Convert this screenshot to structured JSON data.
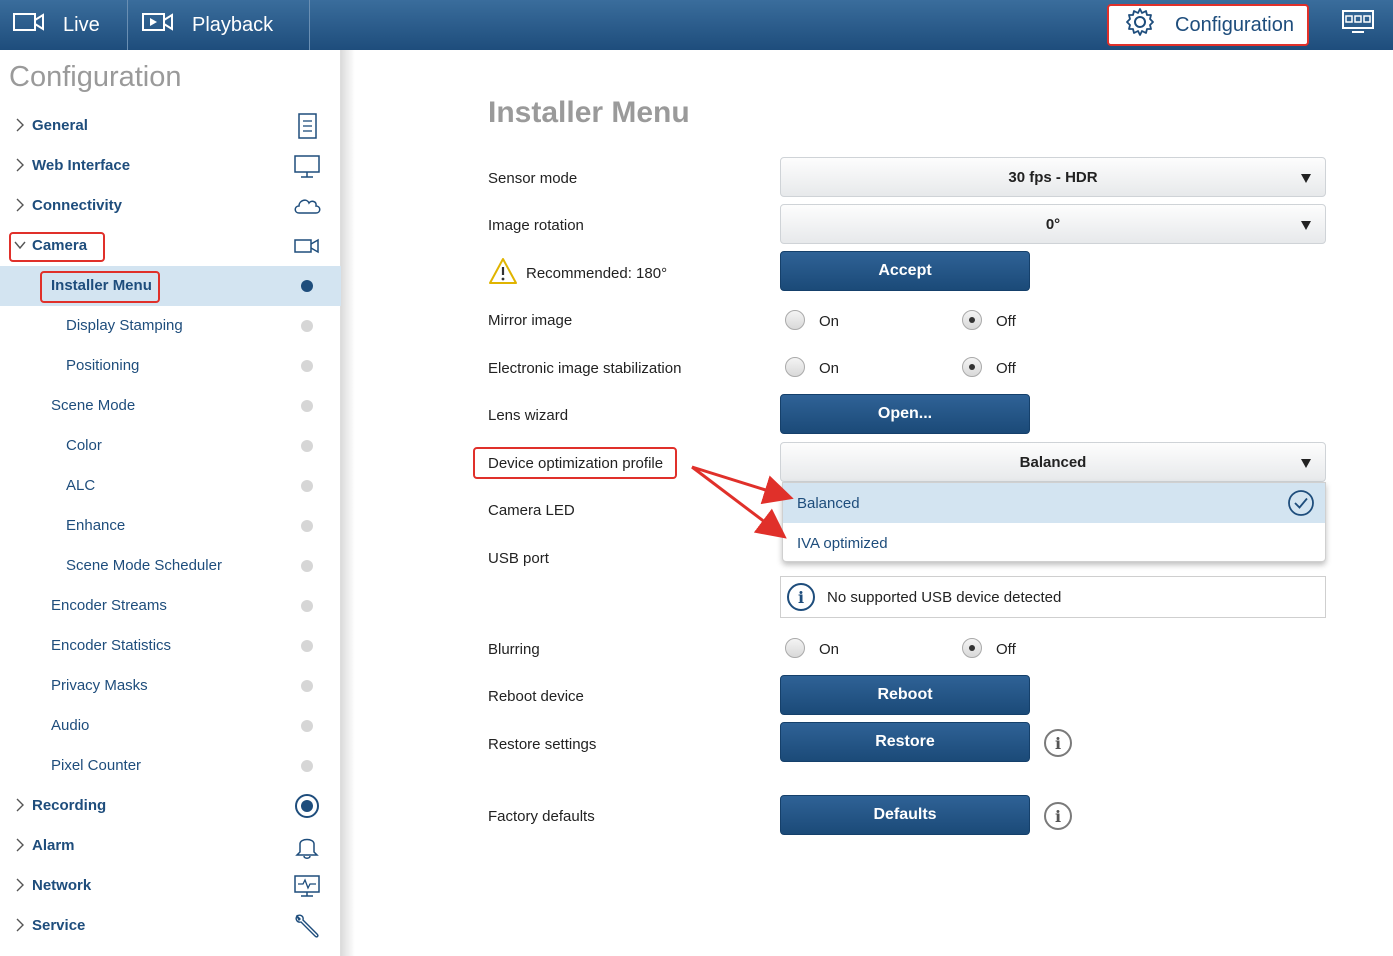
{
  "topbar": {
    "tabs": [
      {
        "label": "Live",
        "icon": "camera-icon"
      },
      {
        "label": "Playback",
        "icon": "playback-icon"
      },
      {
        "label": "Configuration",
        "icon": "gear-icon"
      },
      {
        "label": "",
        "icon": "monitor-grid-icon"
      }
    ]
  },
  "sidebar": {
    "title": "Configuration",
    "items": [
      {
        "label": "General",
        "level": "top",
        "icon": "document-list-icon"
      },
      {
        "label": "Web Interface",
        "level": "top",
        "icon": "monitor-icon"
      },
      {
        "label": "Connectivity",
        "level": "top",
        "icon": "cloud-icon"
      },
      {
        "label": "Camera",
        "level": "top",
        "icon": "video-camera-icon",
        "expanded": true
      },
      {
        "label": "Installer Menu",
        "level": "sub",
        "active": true
      },
      {
        "label": "Display Stamping",
        "level": "sub2"
      },
      {
        "label": "Positioning",
        "level": "sub2"
      },
      {
        "label": "Scene Mode",
        "level": "sub"
      },
      {
        "label": "Color",
        "level": "sub2"
      },
      {
        "label": "ALC",
        "level": "sub2"
      },
      {
        "label": "Enhance",
        "level": "sub2"
      },
      {
        "label": "Scene Mode Scheduler",
        "level": "sub2"
      },
      {
        "label": "Encoder Streams",
        "level": "sub"
      },
      {
        "label": "Encoder Statistics",
        "level": "sub"
      },
      {
        "label": "Privacy Masks",
        "level": "sub"
      },
      {
        "label": "Audio",
        "level": "sub"
      },
      {
        "label": "Pixel Counter",
        "level": "sub"
      },
      {
        "label": "Recording",
        "level": "top",
        "icon": "record-icon"
      },
      {
        "label": "Alarm",
        "level": "top",
        "icon": "bell-icon"
      },
      {
        "label": "Network",
        "level": "top",
        "icon": "network-monitor-icon"
      },
      {
        "label": "Service",
        "level": "top",
        "icon": "wrench-icon"
      }
    ]
  },
  "main": {
    "title": "Installer Menu",
    "sensor_mode": {
      "label": "Sensor mode",
      "value": "30 fps - HDR"
    },
    "image_rotation": {
      "label": "Image rotation",
      "value": "0°"
    },
    "recommended": {
      "text": "Recommended: 180°",
      "button": "Accept"
    },
    "mirror_image": {
      "label": "Mirror image",
      "on": "On",
      "off": "Off",
      "selected": "Off"
    },
    "eis": {
      "label": "Electronic image stabilization",
      "on": "On",
      "off": "Off",
      "selected": "Off"
    },
    "lens_wizard": {
      "label": "Lens wizard",
      "button": "Open..."
    },
    "device_profile": {
      "label": "Device optimization profile",
      "value": "Balanced",
      "options": [
        "Balanced",
        "IVA optimized"
      ],
      "selected": "Balanced"
    },
    "camera_led": {
      "label": "Camera LED"
    },
    "usb_port": {
      "label": "USB port",
      "note": "No supported USB device detected"
    },
    "blurring": {
      "label": "Blurring",
      "on": "On",
      "off": "Off",
      "selected": "Off"
    },
    "reboot": {
      "label": "Reboot device",
      "button": "Reboot"
    },
    "restore": {
      "label": "Restore settings",
      "button": "Restore"
    },
    "factory": {
      "label": "Factory defaults",
      "button": "Defaults"
    }
  },
  "colors": {
    "brand": "#1e4d7c",
    "highlight": "#e0302a",
    "active_bg": "#d3e4f1"
  }
}
